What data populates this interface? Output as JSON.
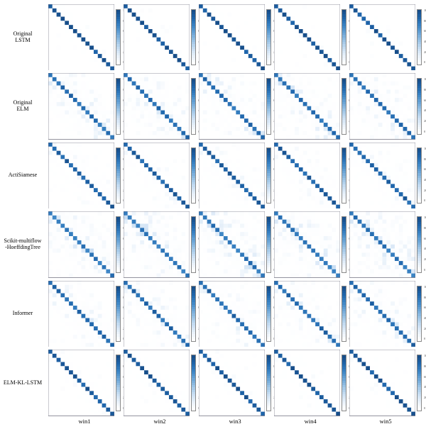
{
  "chart_data": {
    "type": "heatmap",
    "description": "6×5 grid of confusion-matrix heatmaps; rows are methods, columns are time windows. Each heatmap is ~16×16, diagonal-dominant; value ~100 on diagonal, ~0 off-diagonal, with scattered light off-diagonal noise varying by method.",
    "matrix_size": 16,
    "value_range": [
      0,
      100
    ],
    "colormap": [
      "#ffffff",
      "#e8f1fa",
      "#c9def3",
      "#9cc4e6",
      "#6ba5d6",
      "#3c85c5",
      "#1f66ac",
      "#174e8a"
    ],
    "rows": [
      {
        "id": "original_lstm",
        "label": "Original\nLSTM",
        "diag_strength": 0.95,
        "noise": 0.03
      },
      {
        "id": "original_elm",
        "label": "Original\nELM",
        "diag_strength": 0.82,
        "noise": 0.14
      },
      {
        "id": "actisiamese",
        "label": "ActiSiamese",
        "diag_strength": 0.88,
        "noise": 0.07
      },
      {
        "id": "scikit_multiflow_hoeffding",
        "label": "Scikit-multiflow\n-HoeffdingTree",
        "diag_strength": 0.78,
        "noise": 0.17
      },
      {
        "id": "informer",
        "label": "Informer",
        "diag_strength": 0.84,
        "noise": 0.12
      },
      {
        "id": "elm_kl_lstm",
        "label": "ELM-KL-LSTM",
        "diag_strength": 0.93,
        "noise": 0.04
      }
    ],
    "cols": [
      {
        "id": "win1",
        "label": "win1"
      },
      {
        "id": "win2",
        "label": "win2"
      },
      {
        "id": "win3",
        "label": "win3"
      },
      {
        "id": "win4",
        "label": "win4"
      },
      {
        "id": "win5",
        "label": "win5"
      }
    ],
    "colorbar_ticks": [
      "100",
      "80",
      "60",
      "40",
      "20",
      "0"
    ]
  }
}
